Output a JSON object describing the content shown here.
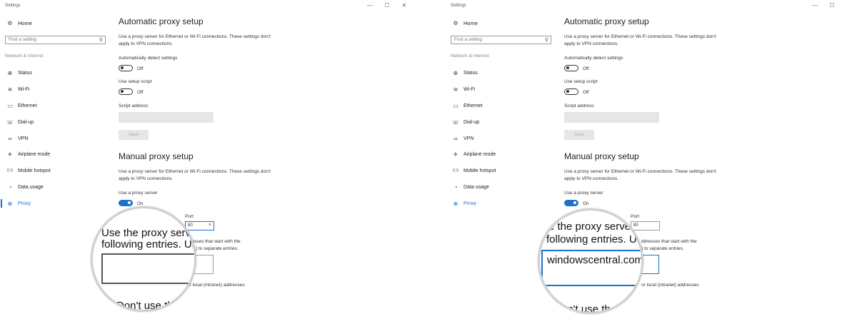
{
  "window": {
    "title": "Settings",
    "minimize_glyph": "—",
    "maximize_glyph": "☐",
    "close_glyph": "✕"
  },
  "sidebar": {
    "home": "Home",
    "home_icon": "gear-icon",
    "search_placeholder": "Find a setting",
    "section": "Network & Internet",
    "items": [
      {
        "label": "Status",
        "icon": "globe-icon",
        "glyph": "⊕"
      },
      {
        "label": "Wi-Fi",
        "icon": "wifi-icon",
        "glyph": "≋"
      },
      {
        "label": "Ethernet",
        "icon": "ethernet-icon",
        "glyph": "▭"
      },
      {
        "label": "Dial-up",
        "icon": "dialup-icon",
        "glyph": "☏"
      },
      {
        "label": "VPN",
        "icon": "vpn-icon",
        "glyph": "∞"
      },
      {
        "label": "Airplane mode",
        "icon": "airplane-icon",
        "glyph": "✈"
      },
      {
        "label": "Mobile hotspot",
        "icon": "hotspot-icon",
        "glyph": "((·))"
      },
      {
        "label": "Data usage",
        "icon": "data-usage-icon",
        "glyph": "◔"
      },
      {
        "label": "Proxy",
        "icon": "proxy-icon",
        "glyph": "⊕",
        "active": true
      }
    ]
  },
  "automatic": {
    "heading": "Automatic proxy setup",
    "description": "Use a proxy server for Ethernet or Wi-Fi connections. These settings don't apply to VPN connections.",
    "detect_label": "Automatically detect settings",
    "detect_state": "Off",
    "script_label": "Use setup script",
    "script_state": "Off",
    "address_label": "Script address",
    "address_value": "",
    "save_label": "Save"
  },
  "manual": {
    "heading": "Manual proxy setup",
    "description": "Use a proxy server for Ethernet or Wi-Fi connections. These settings don't apply to VPN connections.",
    "use_label": "Use a proxy server",
    "use_state": "On",
    "port_label": "Port",
    "port_value": "80",
    "exceptions_tail_1": "ddresses that start with the",
    "exceptions_tail_2": ") to separate entries.",
    "local_tail": "or local (intranet) addresses"
  },
  "magnifier_left": {
    "line1": "Use the proxy server e",
    "line2": "following entries. Use se",
    "bottom": "Don't use the"
  },
  "magnifier_right": {
    "line1": "e the proxy server",
    "line2": "following entries. Use s",
    "typed": "windowscentral.com",
    "bottom": "on't use th"
  },
  "accent": "#1a73c8"
}
